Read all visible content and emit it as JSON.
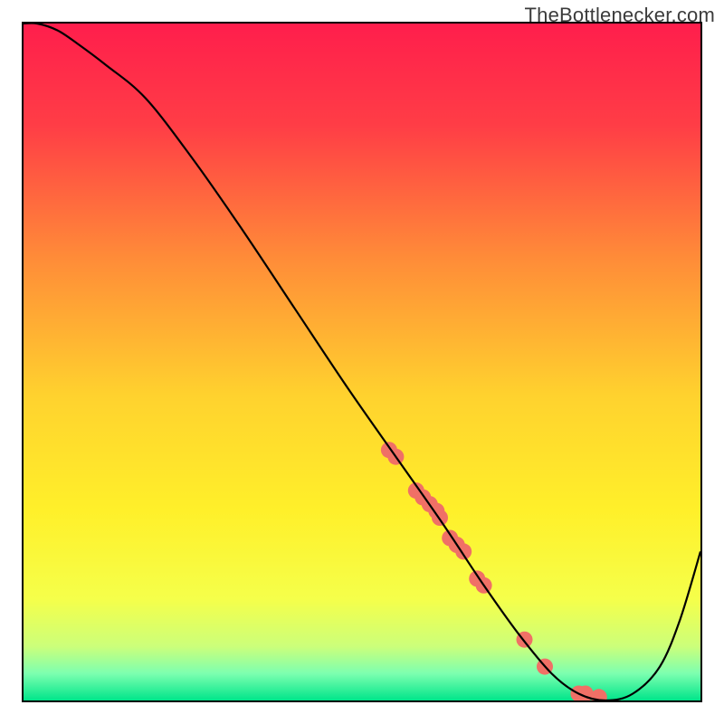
{
  "watermark": "TheBottlenecker.com",
  "chart_data": {
    "type": "line",
    "title": "",
    "xlabel": "",
    "ylabel": "",
    "xlim": [
      0,
      100
    ],
    "ylim": [
      0,
      100
    ],
    "x": [
      0,
      2,
      5,
      8,
      12,
      18,
      25,
      32,
      40,
      48,
      55,
      62,
      68,
      73,
      78,
      82,
      86,
      90,
      94,
      97,
      100
    ],
    "values": [
      100,
      100,
      99,
      97,
      94,
      89,
      80,
      70,
      58,
      46,
      36,
      26,
      17,
      10,
      4,
      1,
      0,
      1,
      5,
      12,
      22
    ],
    "series": [
      {
        "name": "curve",
        "x": [
          0,
          2,
          5,
          8,
          12,
          18,
          25,
          32,
          40,
          48,
          55,
          62,
          68,
          73,
          78,
          82,
          86,
          90,
          94,
          97,
          100
        ],
        "values": [
          100,
          100,
          99,
          97,
          94,
          89,
          80,
          70,
          58,
          46,
          36,
          26,
          17,
          10,
          4,
          1,
          0,
          1,
          5,
          12,
          22
        ]
      },
      {
        "name": "markers",
        "x": [
          54,
          55,
          58,
          59,
          60,
          61,
          61.5,
          63,
          64,
          65,
          67,
          68,
          74,
          77,
          82,
          83,
          85
        ],
        "values": [
          37,
          36,
          31,
          30,
          29,
          28,
          27,
          24,
          23,
          22,
          18,
          17,
          9,
          5,
          1,
          1,
          0.5
        ]
      }
    ],
    "background": {
      "type": "vertical-gradient",
      "stops": [
        {
          "offset": 0.0,
          "color": "#ff1e4c"
        },
        {
          "offset": 0.15,
          "color": "#ff3d46"
        },
        {
          "offset": 0.35,
          "color": "#ff8d38"
        },
        {
          "offset": 0.55,
          "color": "#ffd22e"
        },
        {
          "offset": 0.72,
          "color": "#fff02a"
        },
        {
          "offset": 0.85,
          "color": "#f5ff4a"
        },
        {
          "offset": 0.92,
          "color": "#ccff7a"
        },
        {
          "offset": 0.96,
          "color": "#7dffb0"
        },
        {
          "offset": 1.0,
          "color": "#00e58a"
        }
      ]
    },
    "marker_style": {
      "color": "#f07066",
      "radius": 9
    }
  }
}
